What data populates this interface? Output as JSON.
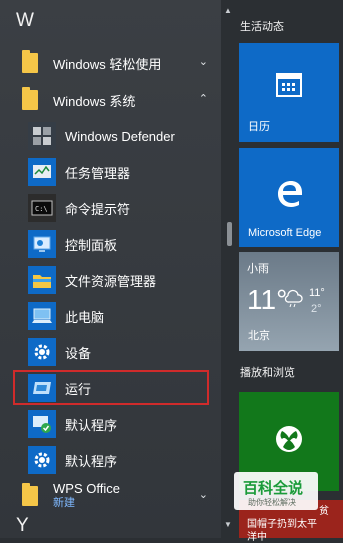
{
  "left": {
    "section_w": "W",
    "section_bottom": "Y",
    "apps": [
      {
        "label": "Windows 轻松使用",
        "chevron": "⌄"
      },
      {
        "label": "Windows 系统",
        "chevron": "⌃"
      },
      {
        "label": "Windows Defender"
      },
      {
        "label": "任务管理器"
      },
      {
        "label": "命令提示符"
      },
      {
        "label": "控制面板"
      },
      {
        "label": "文件资源管理器"
      },
      {
        "label": "此电脑"
      },
      {
        "label": "设备"
      },
      {
        "label": "运行"
      },
      {
        "label": "默认程序"
      },
      {
        "label": "默认程序"
      },
      {
        "label": "WPS Office",
        "sub": "新建",
        "chevron": "⌄"
      }
    ]
  },
  "right": {
    "group1": "生活动态",
    "calendar_label": "日历",
    "edge_label": "Microsoft Edge",
    "weather": {
      "condition": "小雨",
      "temp": "11°",
      "high": "11°",
      "low": "2°",
      "city": "北京"
    },
    "group2": "播放和浏览",
    "news_line1": "贫",
    "news_line2": "国帽子扔到太平",
    "news_line3": "洋中"
  },
  "watermark": {
    "title": "百科全说",
    "subtitle": "助你轻松解决"
  },
  "colors": {
    "accent": "#0e6ac7",
    "xbox": "#12781b",
    "highlight": "#d02b2b",
    "folder": "#f5c648"
  }
}
